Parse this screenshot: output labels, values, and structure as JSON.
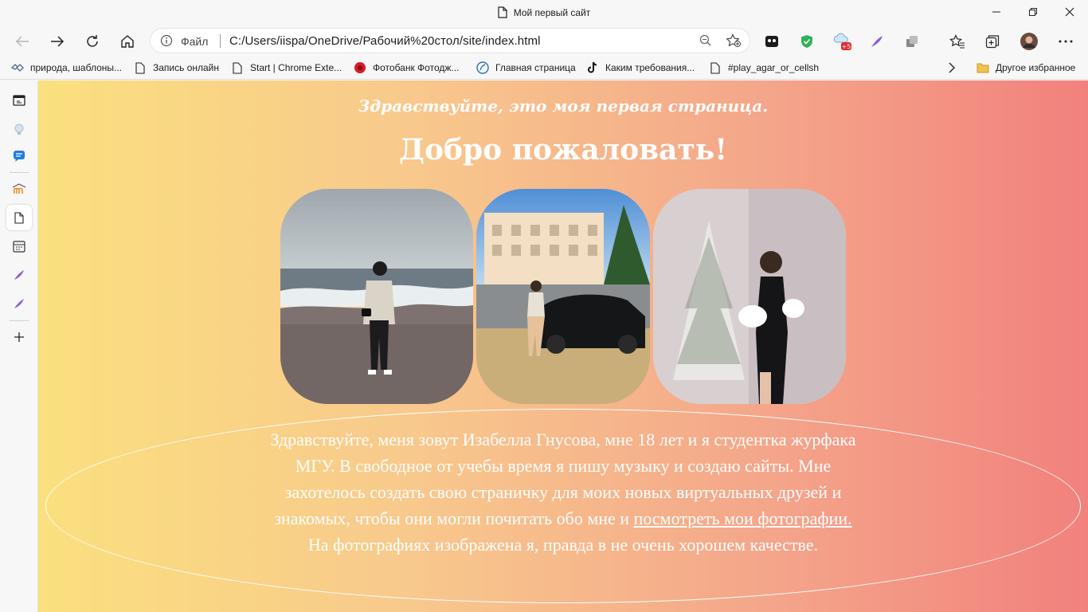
{
  "window": {
    "title": "Мой первый сайт"
  },
  "toolbar": {
    "scheme_label": "Файл",
    "url": "C:/Users/iispa/OneDrive/Рабочий%20стол/site/index.html",
    "extension_badge": "+5"
  },
  "favorites": [
    {
      "label": "природа, шаблоны...",
      "icon": "nature-favicon"
    },
    {
      "label": "Запись онлайн",
      "icon": "page-icon"
    },
    {
      "label": "Start | Chrome Exte...",
      "icon": "page-icon"
    },
    {
      "label": "Фотобанк Фотодж...",
      "icon": "red-circle-favicon"
    },
    {
      "label": "Главная страница",
      "icon": "blue-circle-favicon"
    },
    {
      "label": "Каким требования...",
      "icon": "tiktok-favicon"
    },
    {
      "label": "#play_agar_or_cellsh",
      "icon": "page-icon"
    }
  ],
  "other_favorites": "Другое избранное",
  "page": {
    "greeting": "Здравствуйте, это моя первая страница.",
    "welcome": "Добро пожаловать!",
    "about_before_link": "Здравствуйте, меня зовут Изабелла Гнусова, мне 18 лет и я студентка журфака МГУ. В свободное от учебы время я пишу музыку и создаю сайты. Мне захотелось создать свою страничку для моих новых виртуальных друзей и знакомых, чтобы они могли почитать обо мне и ",
    "about_link": "посмотреть мои фотографии.",
    "about_after_link": " На фотографиях изображена я, правда в не очень хорошем качестве."
  },
  "colors": {
    "gradient_start": "#fae07e",
    "gradient_end": "#f2817d",
    "text": "#ffffff"
  }
}
